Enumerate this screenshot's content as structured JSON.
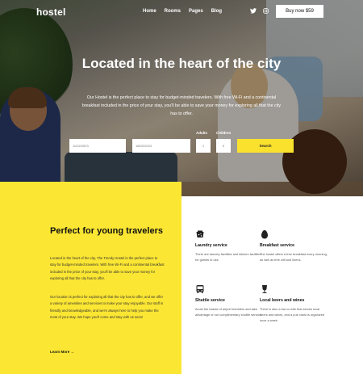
{
  "brand": "hostel",
  "nav": {
    "items": [
      "Home",
      "Rooms",
      "Pages",
      "Blog"
    ],
    "buy_label": "Buy now $59"
  },
  "social": {
    "twitter_glyph": "𝕏",
    "instagram_glyph": "◎"
  },
  "hero": {
    "title": "Located in the heart of the city",
    "text": "Our Hostel is the perfect place to stay for budget-minded travelers. With free Wi-Fi and a continental breakfast included in the price of your stay, you'll be able to save your money for exploring all that the city has to offer."
  },
  "booking": {
    "checkin_label": "",
    "checkin_value": "11/02/2023",
    "checkout_label": "",
    "checkout_value": "18/02/2023",
    "adults_label": "Adults",
    "adults_value": "1",
    "children_label": "Children",
    "children_value": "0",
    "search_label": "Search"
  },
  "about": {
    "title": "Perfect for young travelers",
    "p1": "Located in the heart of the city, The Trendy Hostel is the perfect place to stay for budget-minded travelers. With free Wi-Fi and a continental breakfast included in the price of your stay, you'll be able to save your money for exploring all that the city has to offer.",
    "p2": "Our location is perfect for exploring all that the city has to offer, and we offer a variety of amenities and services to make your stay enjoyable. Our staff is friendly and knowledgeable, and we're always here to help you make the most of your stay. We hope you'll come and stay with us soon!",
    "link": "Learn More →"
  },
  "services": [
    {
      "icon": "laundry-icon",
      "title": "Laundry service",
      "text": "There are laundry facilities and kitchen facilities for guests to use."
    },
    {
      "icon": "egg-icon",
      "title": "Breakfast service",
      "text": "The hostel offers a free breakfast every morning, as well as free wifi and linens."
    },
    {
      "icon": "bus-icon",
      "title": "Shuttle service",
      "text": "Avoid the hassle of airport transfers and take advantage of our complimentary shuttle service."
    },
    {
      "icon": "beer-icon",
      "title": "Local beers and wines",
      "text": "There is also a bar on-site that serves local beers and wines, and a pub crawl is organized once a week."
    }
  ],
  "colors": {
    "accent": "#fbe633",
    "button": "#f9e12d"
  }
}
